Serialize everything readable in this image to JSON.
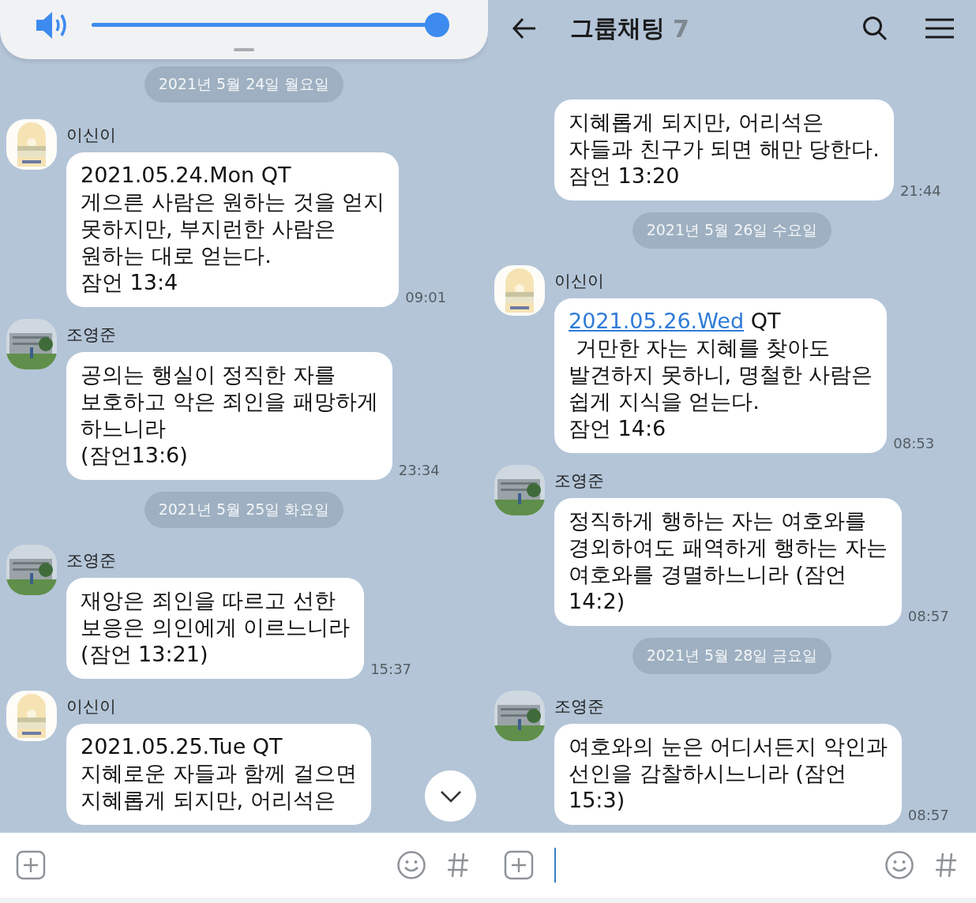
{
  "panels": [
    {
      "volume": {
        "level": 0.97
      },
      "scroll_down": true,
      "items": [
        {
          "kind": "date",
          "text": "2021년 5월 24일 월요일"
        },
        {
          "kind": "message",
          "name": "이신이",
          "avatar": {
            "kind": "poster"
          },
          "text": "2021.05.24.Mon QT\n게으른 사람은 원하는 것을 얻지\n못하지만, 부지런한 사람은\n원하는 대로 얻는다.\n잠언 13:4",
          "time": "09:01"
        },
        {
          "kind": "message",
          "name": "조영준",
          "text": "공의는 행실이 정직한 자를\n보호하고 악은 죄인을 패망하게\n하느니라\n(잠언13:6)",
          "time": "23:34"
        },
        {
          "kind": "date",
          "text": "2021년 5월 25일 화요일"
        },
        {
          "kind": "message",
          "name": "조영준",
          "text": "재앙은 죄인을 따르고 선한\n보응은 의인에게 이르느니라\n(잠언 13:21)",
          "time": "15:37"
        },
        {
          "kind": "message",
          "name": "이신이",
          "avatar": {
            "kind": "poster"
          },
          "text": "2021.05.25.Tue QT\n지혜로운 자들과 함께 걸으면\n지혜롭게 되지만, 어리석은"
        }
      ]
    },
    {
      "header": {
        "title": "그룹채팅",
        "count": "7"
      },
      "input": {
        "focused": true
      },
      "items": [
        {
          "kind": "message",
          "text": "지혜롭게 되지만, 어리석은\n자들과 친구가 되면 해만 당한다.\n잠언 13:20",
          "time": "21:44"
        },
        {
          "kind": "date",
          "text": "2021년 5월 26일 수요일"
        },
        {
          "kind": "message",
          "name": "이신이",
          "avatar": {
            "kind": "poster"
          },
          "link": "2021.05.26.Wed",
          "text": " QT\n 거만한 자는 지혜를 찾아도\n발견하지 못하니, 명철한 사람은\n쉽게 지식을 얻는다.\n잠언 14:6",
          "time": "08:53"
        },
        {
          "kind": "message",
          "name": "조영준",
          "text": "정직하게 행하는 자는 여호와를\n경외하여도 패역하게 행하는 자는\n여호와를 경멸하느니라 (잠언\n14:2)",
          "time": "08:57"
        },
        {
          "kind": "date",
          "text": "2021년 5월 28일 금요일"
        },
        {
          "kind": "message",
          "name": "조영준",
          "text": "여호와의 눈은 어디서든지 악인과\n선인을 감찰하시느니라 (잠언\n15:3)",
          "time": "08:57"
        }
      ]
    }
  ]
}
